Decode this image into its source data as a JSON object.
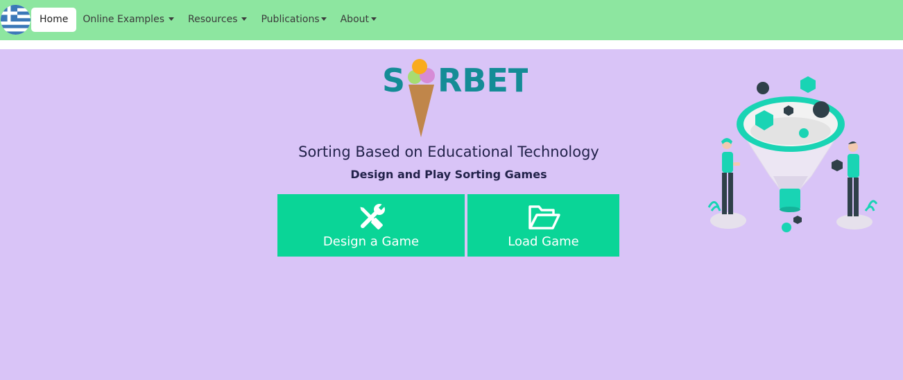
{
  "nav": {
    "flag_label": "Greek language flag",
    "items": [
      {
        "label": "Home",
        "active": true,
        "dropdown": false
      },
      {
        "label": "Online Examples",
        "active": false,
        "dropdown": true
      },
      {
        "label": "Resources",
        "active": false,
        "dropdown": true
      },
      {
        "label": "Publications",
        "active": false,
        "dropdown": true
      },
      {
        "label": "About",
        "active": false,
        "dropdown": true
      }
    ]
  },
  "logo": {
    "text_left": "S",
    "text_right": "RBET"
  },
  "hero": {
    "title": "Sorting Based on Educational Technology",
    "subtitle": "Design and Play Sorting Games"
  },
  "buttons": {
    "design": {
      "label": "Design a Game",
      "icon": "tools-icon"
    },
    "load": {
      "label": "Load Game",
      "icon": "folder-open-icon"
    }
  },
  "colors": {
    "navbar": "#8de6a0",
    "background": "#d9c4f7",
    "button": "#0ad597",
    "logo_text": "#148c96",
    "title_text": "#22224a"
  }
}
